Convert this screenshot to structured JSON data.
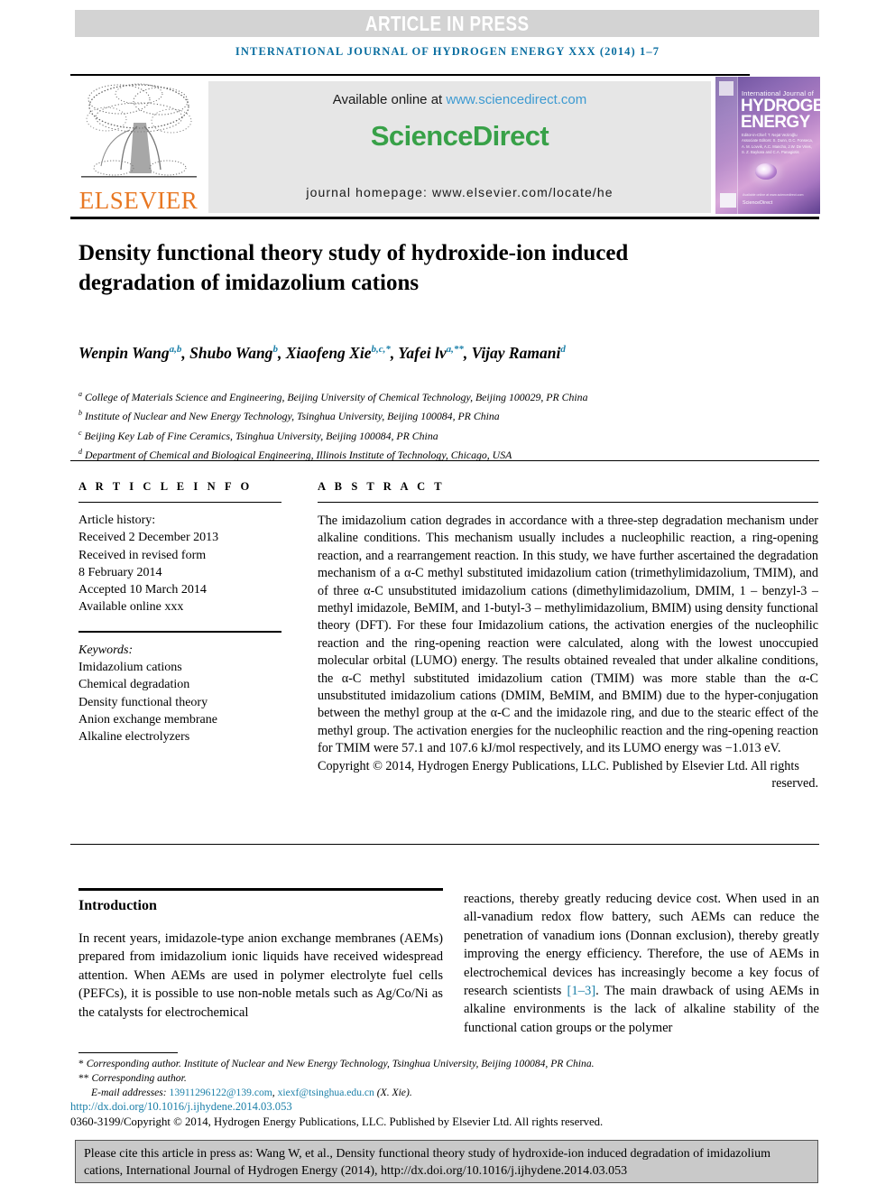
{
  "banner": {
    "text": "ARTICLE IN PRESS",
    "bg_color": "#d3d3d3",
    "text_color": "#ffffff"
  },
  "running_head": {
    "text": "INTERNATIONAL JOURNAL OF HYDROGEN ENERGY XXX (2014) 1–7",
    "color": "#0a6ea0"
  },
  "masthead": {
    "publisher_logo_label": "ELSEVIER",
    "publisher_color": "#e87722",
    "available_online_prefix": "Available online at ",
    "available_online_url": "www.sciencedirect.com",
    "sciencedirect_label": "ScienceDirect",
    "sciencedirect_color": "#38a148",
    "journal_homepage": "journal homepage: www.elsevier.com/locate/he",
    "cover": {
      "line1": "International Journal of",
      "line2": "HYDROGEN",
      "line3": "ENERGY",
      "editors": "Editor-in-Chief: T. Nejat Veziroğlu   Associate Editors: S. Dunn, D.C. Fonseca, A. M. Lovvik, A.C. Mancho, J.W. De Vries, S. Z. Baykara and C.A. Panagiotis",
      "sciencedirect_tag": "ScienceDirect",
      "availability_tag": "Available online at www.sciencedirect.com"
    }
  },
  "article": {
    "title": "Density functional theory study of hydroxide-ion induced degradation of imidazolium cations",
    "authors_html": "Wenpin Wang<sup>a,b</sup>, Shubo Wang<sup>b</sup>, Xiaofeng Xie<sup>b,c,*</sup>, Yafei lv<sup>a,**</sup>, Vijay Ramani<sup>d</sup>",
    "affiliations": [
      {
        "marker": "a",
        "text": "College of Materials Science and Engineering, Beijing University of Chemical Technology, Beijing 100029, PR China"
      },
      {
        "marker": "b",
        "text": "Institute of Nuclear and New Energy Technology, Tsinghua University, Beijing 100084, PR China"
      },
      {
        "marker": "c",
        "text": "Beijing Key Lab of Fine Ceramics, Tsinghua University, Beijing 100084, PR China"
      },
      {
        "marker": "d",
        "text": "Department of Chemical and Biological Engineering, Illinois Institute of Technology, Chicago, USA"
      }
    ]
  },
  "article_info": {
    "heading": "A R T I C L E   I N F O",
    "history_label": "Article history:",
    "history": [
      "Received 2 December 2013",
      "Received in revised form",
      "8 February 2014",
      "Accepted 10 March 2014",
      "Available online xxx"
    ],
    "keywords_label": "Keywords:",
    "keywords": [
      "Imidazolium cations",
      "Chemical degradation",
      "Density functional theory",
      "Anion exchange membrane",
      "Alkaline electrolyzers"
    ]
  },
  "abstract": {
    "heading": "A B S T R A C T",
    "body": "The imidazolium cation degrades in accordance with a three-step degradation mechanism under alkaline conditions. This mechanism usually includes a nucleophilic reaction, a ring-opening reaction, and a rearrangement reaction. In this study, we have further ascertained the degradation mechanism of a α-C methyl substituted imidazolium cation (trimethylimidazolium, TMIM), and of three α-C unsubstituted imidazolium cations (dimethylimidazolium, DMIM, 1 – benzyl-3 – methyl imidazole, BeMIM, and 1-butyl-3 – methylimidazolium, BMIM) using density functional theory (DFT). For these four Imidazolium cations, the activation energies of the nucleophilic reaction and the ring-opening reaction were calculated, along with the lowest unoccupied molecular orbital (LUMO) energy. The results obtained revealed that under alkaline conditions, the α-C methyl substituted imidazolium cation (TMIM) was more stable than the α-C unsubstituted imidazolium cations (DMIM, BeMIM, and BMIM) due to the hyper-conjugation between the methyl group at the α-C and the imidazole ring, and due to the stearic effect of the methyl group. The activation energies for the nucleophilic reaction and the ring-opening reaction for TMIM were 57.1 and 107.6 kJ/mol respectively, and its LUMO energy was −1.013 eV.",
    "copyright": "Copyright © 2014, Hydrogen Energy Publications, LLC. Published by Elsevier Ltd. All rights",
    "copyright_tail": "reserved."
  },
  "body": {
    "section_heading": "Introduction",
    "left_column": "In recent years, imidazole-type anion exchange membranes (AEMs) prepared from imidazolium ionic liquids have received widespread attention. When AEMs are used in polymer electrolyte fuel cells (PEFCs), it is possible to use non-noble metals such as Ag/Co/Ni as the catalysts for electrochemical",
    "right_column_part1": "reactions, thereby greatly reducing device cost. When used in an all-vanadium redox flow battery, such AEMs can reduce the penetration of vanadium ions (Donnan exclusion), thereby greatly improving the energy efficiency. Therefore, the use of AEMs in electrochemical devices has increasingly become a key focus of research scientists ",
    "right_column_ref": "[1–3]",
    "right_column_part2": ". The main drawback of using AEMs in alkaline environments is the lack of alkaline stability of the functional cation groups or the polymer"
  },
  "footnotes": {
    "star1_marker": "*",
    "star1_text": "Corresponding author. Institute of Nuclear and New Energy Technology, Tsinghua University, Beijing 100084, PR China.",
    "star2_marker": "**",
    "star2_text": "Corresponding author.",
    "email_label": "E-mail addresses:",
    "email1": "13911296122@139.com",
    "email2": "xiexf@tsinghua.edu.cn",
    "email_attrib": "(X. Xie).",
    "doi": "http://dx.doi.org/10.1016/j.ijhydene.2014.03.053",
    "copyright_line": "0360-3199/Copyright © 2014, Hydrogen Energy Publications, LLC. Published by Elsevier Ltd. All rights reserved."
  },
  "cite_box": {
    "text": "Please cite this article in press as: Wang W, et al., Density functional theory study of hydroxide-ion induced degradation of imidazolium cations, International Journal of Hydrogen Energy (2014), http://dx.doi.org/10.1016/j.ijhydene.2014.03.053"
  }
}
